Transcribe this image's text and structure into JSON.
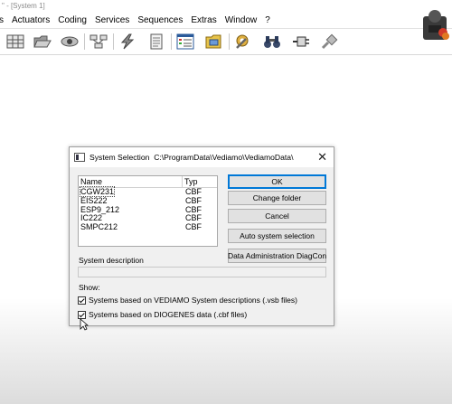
{
  "window": {
    "title": "\" - [System 1]"
  },
  "menu": [
    "s",
    "Actuators",
    "Coding",
    "Services",
    "Sequences",
    "Extras",
    "Window",
    "?"
  ],
  "toolbar_icons": [
    "table-icon",
    "folder-open-icon",
    "eye-icon",
    "network-icon",
    "flash-icon",
    "document-icon",
    "list-window-icon",
    "folder-tree-icon",
    "tools-icon",
    "binoculars-icon",
    "plug-icon",
    "disconnect-icon"
  ],
  "dialog": {
    "title": "System Selection",
    "path": "C:\\ProgramData\\Vediamo\\VediamoData\\",
    "close_glyph": "✕",
    "columns": {
      "name": "Name",
      "typ": "Typ"
    },
    "rows": [
      {
        "name": "CGW231",
        "typ": "CBF"
      },
      {
        "name": "EIS222",
        "typ": "CBF"
      },
      {
        "name": "ESP9_212",
        "typ": "CBF"
      },
      {
        "name": "IC222",
        "typ": "CBF"
      },
      {
        "name": "SMPC212",
        "typ": "CBF"
      }
    ],
    "buttons": {
      "ok": "OK",
      "change_folder": "Change folder",
      "cancel": "Cancel",
      "auto": "Auto system selection",
      "data_admin": "Data Administration DiagCon"
    },
    "system_description_label": "System description",
    "system_description_value": "",
    "show_label": "Show:",
    "checkbox_vediamo": "Systems based on VEDIAMO System descriptions (.vsb files)",
    "checkbox_diogenes": "Systems based on DIOGENES data (.cbf files)",
    "checkbox_vediamo_checked": true,
    "checkbox_diogenes_checked": true
  },
  "colors": {
    "accent": "#0078d7",
    "dialog_bg": "#f0f0f0"
  }
}
